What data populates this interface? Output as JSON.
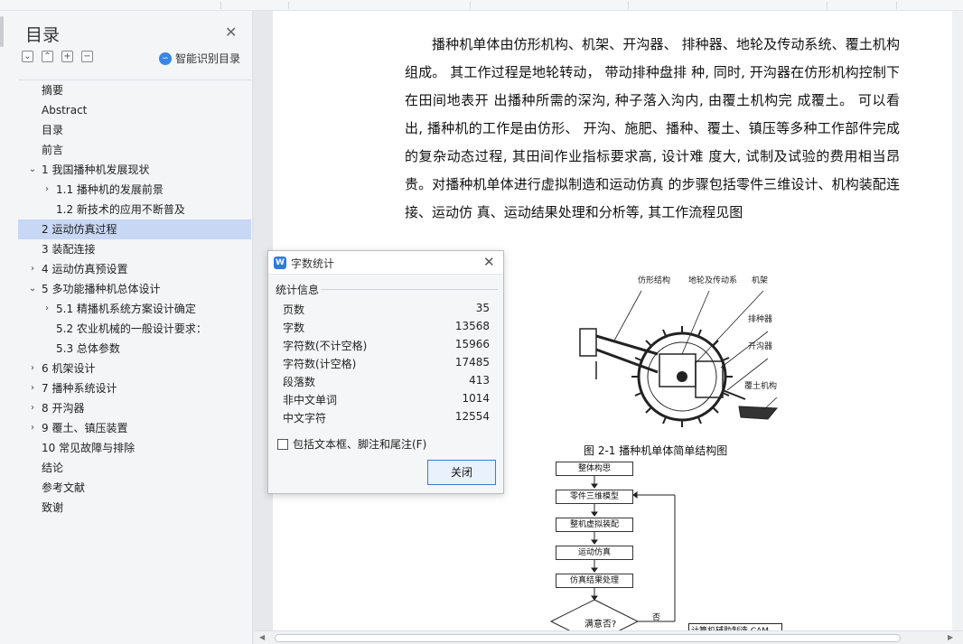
{
  "nav": {
    "title": "目录",
    "smart_toc_label": "智能识别目录",
    "items": [
      {
        "label": "摘要",
        "level": 0,
        "chevron": ""
      },
      {
        "label": "Abstract",
        "level": 0,
        "chevron": ""
      },
      {
        "label": "目录",
        "level": 0,
        "chevron": ""
      },
      {
        "label": "前言",
        "level": 0,
        "chevron": ""
      },
      {
        "label": "1 我国播种机发展现状",
        "level": 0,
        "chevron": "down"
      },
      {
        "label": "1.1 播种机的发展前景",
        "level": 1,
        "chevron": "right"
      },
      {
        "label": "1.2 新技术的应用不断普及",
        "level": 1,
        "chevron": ""
      },
      {
        "label": "2 运动仿真过程",
        "level": 0,
        "chevron": "",
        "active": true
      },
      {
        "label": "3 装配连接",
        "level": 0,
        "chevron": ""
      },
      {
        "label": "4  运动仿真预设置",
        "level": 0,
        "chevron": "right"
      },
      {
        "label": "5 多功能播种机总体设计",
        "level": 0,
        "chevron": "down"
      },
      {
        "label": "5.1 精播机系统方案设计确定",
        "level": 1,
        "chevron": "right"
      },
      {
        "label": "5.2 农业机械的一般设计要求：",
        "level": 1,
        "chevron": ""
      },
      {
        "label": "5.3 总体参数",
        "level": 1,
        "chevron": ""
      },
      {
        "label": "6 机架设计",
        "level": 0,
        "chevron": "right"
      },
      {
        "label": "7 播种系统设计",
        "level": 0,
        "chevron": "right"
      },
      {
        "label": "8 开沟器",
        "level": 0,
        "chevron": "right"
      },
      {
        "label": "9 覆土、镇压装置",
        "level": 0,
        "chevron": "right"
      },
      {
        "label": "10  常见故障与排除",
        "level": 0,
        "chevron": ""
      },
      {
        "label": "结论",
        "level": 0,
        "chevron": ""
      },
      {
        "label": "参考文献",
        "level": 0,
        "chevron": ""
      },
      {
        "label": "致谢",
        "level": 0,
        "chevron": ""
      }
    ]
  },
  "document": {
    "paragraph": "播种机单体由仿形机构、机架、开沟器、 排种器、地轮及传动系统、覆土机构组成。 其工作过程是地轮转动， 带动排种盘排 种, 同时, 开沟器在仿形机构控制下在田间地表开 出播种所需的深沟, 种子落入沟内, 由覆土机构完 成覆土。 可以看出, 播种机的工作是由仿形、 开沟、施肥、播种、覆土、镇压等多种工作部件完成 的复杂动态过程, 其田间作业指标要求高, 设计难 度大, 试制及试验的费用相当昂贵。对播种机单体进行虚拟制造和运动仿真 的步骤包括零件三维设计、机构装配连接、运动仿 真、运动结果处理和分析等, 其工作流程见图",
    "figure_labels": {
      "profiling": "仿形结构",
      "wheel": "地轮及传动系",
      "frame": "机架",
      "seeder": "排种器",
      "opener": "开沟器",
      "cover": "覆土机构"
    },
    "figure_caption": "图  2-1 播种机单体简单结构图",
    "flow": {
      "step1": "整体构思",
      "step2": "零件三维模型",
      "step3": "整机虚拟装配",
      "step4": "运动仿真",
      "step5": "仿真结果处理",
      "decision": "满意否?",
      "no_label": "否",
      "side_box": "计算机辅助制造 CAM"
    }
  },
  "dialog": {
    "title": "字数统计",
    "section": "统计信息",
    "stats": [
      {
        "label": "页数",
        "value": "35"
      },
      {
        "label": "字数",
        "value": "13568"
      },
      {
        "label": "字符数(不计空格)",
        "value": "15966"
      },
      {
        "label": "字符数(计空格)",
        "value": "17485"
      },
      {
        "label": "段落数",
        "value": "413"
      },
      {
        "label": "非中文单词",
        "value": "1014"
      },
      {
        "label": "中文字符",
        "value": "12554"
      }
    ],
    "checkbox_label": "包括文本框、脚注和尾注(F)",
    "close_button": "关闭"
  },
  "icons": {
    "app": "wps-writer-icon",
    "smart_toc": "smart-toc-icon"
  }
}
